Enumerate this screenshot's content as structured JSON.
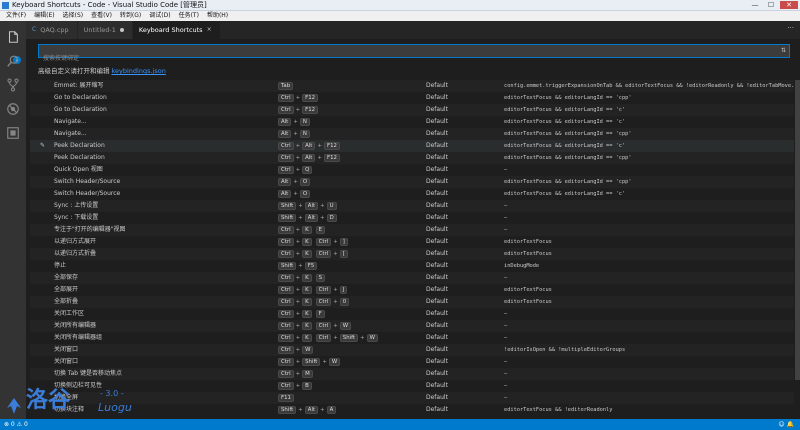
{
  "window": {
    "title": "Keyboard Shortcuts - Code - Visual Studio Code [管理员]",
    "minimize": "—",
    "maximize": "☐",
    "close": "✕"
  },
  "menu": [
    "文件(F)",
    "编辑(E)",
    "选择(S)",
    "查看(V)",
    "转到(G)",
    "调试(D)",
    "任务(T)",
    "帮助(H)"
  ],
  "activity": {
    "badge": "1",
    "icons": [
      "files-icon",
      "search-icon",
      "source-control-icon",
      "debug-icon",
      "extensions-icon"
    ]
  },
  "tabs": [
    {
      "label": "QAQ.cpp",
      "icon": "C",
      "active": false
    },
    {
      "label": "Untitled-1",
      "icon": "",
      "active": false
    },
    {
      "label": "Keyboard Shortcuts",
      "icon": "",
      "active": true
    }
  ],
  "tab_close": "×",
  "tabbar_more": "···",
  "search": {
    "placeholder": "搜索按键绑定",
    "sort_icon": "⇅"
  },
  "hint": {
    "text": "高级自定义请打开和编辑",
    "link": "keybindings.json"
  },
  "edit_icon": "✎",
  "rows": [
    {
      "cmd": "Emmet: 展开缩写",
      "keys": [
        [
          "Tab"
        ]
      ],
      "src": "Default",
      "when": "config.emmet.triggerExpansionOnTab && editorTextFocus && !editorReadonly && !editorTabMove..."
    },
    {
      "cmd": "Go to Declaration",
      "keys": [
        [
          "Ctrl",
          "F12"
        ]
      ],
      "src": "Default",
      "when": "editorTextFocus && editorLangId == 'cpp'"
    },
    {
      "cmd": "Go to Declaration",
      "keys": [
        [
          "Ctrl",
          "F12"
        ]
      ],
      "src": "Default",
      "when": "editorTextFocus && editorLangId == 'c'"
    },
    {
      "cmd": "Navigate...",
      "keys": [
        [
          "Alt",
          "N"
        ]
      ],
      "src": "Default",
      "when": "editorTextFocus && editorLangId == 'c'"
    },
    {
      "cmd": "Navigate...",
      "keys": [
        [
          "Alt",
          "N"
        ]
      ],
      "src": "Default",
      "when": "editorTextFocus && editorLangId == 'cpp'"
    },
    {
      "cmd": "Peek Declaration",
      "keys": [
        [
          "Ctrl",
          "Alt",
          "F12"
        ]
      ],
      "src": "Default",
      "when": "editorTextFocus && editorLangId == 'c'",
      "selected": true
    },
    {
      "cmd": "Peek Declaration",
      "keys": [
        [
          "Ctrl",
          "Alt",
          "F12"
        ]
      ],
      "src": "Default",
      "when": "editorTextFocus && editorLangId == 'cpp'"
    },
    {
      "cmd": "Quick Open 视图",
      "keys": [
        [
          "Ctrl",
          "Q"
        ]
      ],
      "src": "Default",
      "when": "—"
    },
    {
      "cmd": "Switch Header/Source",
      "keys": [
        [
          "Alt",
          "O"
        ]
      ],
      "src": "Default",
      "when": "editorTextFocus && editorLangId == 'cpp'"
    },
    {
      "cmd": "Switch Header/Source",
      "keys": [
        [
          "Alt",
          "O"
        ]
      ],
      "src": "Default",
      "when": "editorTextFocus && editorLangId == 'c'"
    },
    {
      "cmd": "Sync : 上传设置",
      "keys": [
        [
          "Shift",
          "Alt",
          "U"
        ]
      ],
      "src": "Default",
      "when": "—"
    },
    {
      "cmd": "Sync : 下载设置",
      "keys": [
        [
          "Shift",
          "Alt",
          "D"
        ]
      ],
      "src": "Default",
      "when": "—"
    },
    {
      "cmd": "专注于\"打开的编辑器\"视图",
      "keys": [
        [
          "Ctrl",
          "K"
        ],
        [
          "E"
        ]
      ],
      "src": "Default",
      "when": "—"
    },
    {
      "cmd": "以递归方式展开",
      "keys": [
        [
          "Ctrl",
          "K"
        ],
        [
          "Ctrl",
          "]"
        ]
      ],
      "src": "Default",
      "when": "editorTextFocus"
    },
    {
      "cmd": "以递归方式折叠",
      "keys": [
        [
          "Ctrl",
          "K"
        ],
        [
          "Ctrl",
          "["
        ]
      ],
      "src": "Default",
      "when": "editorTextFocus"
    },
    {
      "cmd": "停止",
      "keys": [
        [
          "Shift",
          "F5"
        ]
      ],
      "src": "Default",
      "when": "inDebugMode"
    },
    {
      "cmd": "全部保存",
      "keys": [
        [
          "Ctrl",
          "K"
        ],
        [
          "S"
        ]
      ],
      "src": "Default",
      "when": "—"
    },
    {
      "cmd": "全部展开",
      "keys": [
        [
          "Ctrl",
          "K"
        ],
        [
          "Ctrl",
          "J"
        ]
      ],
      "src": "Default",
      "when": "editorTextFocus"
    },
    {
      "cmd": "全部折叠",
      "keys": [
        [
          "Ctrl",
          "K"
        ],
        [
          "Ctrl",
          "0"
        ]
      ],
      "src": "Default",
      "when": "editorTextFocus"
    },
    {
      "cmd": "关闭工作区",
      "keys": [
        [
          "Ctrl",
          "K"
        ],
        [
          "F"
        ]
      ],
      "src": "Default",
      "when": "—"
    },
    {
      "cmd": "关闭所有编辑器",
      "keys": [
        [
          "Ctrl",
          "K"
        ],
        [
          "Ctrl",
          "W"
        ]
      ],
      "src": "Default",
      "when": "—"
    },
    {
      "cmd": "关闭所有编辑器组",
      "keys": [
        [
          "Ctrl",
          "K"
        ],
        [
          "Ctrl",
          "Shift",
          "W"
        ]
      ],
      "src": "Default",
      "when": "—"
    },
    {
      "cmd": "关闭窗口",
      "keys": [
        [
          "Ctrl",
          "W"
        ]
      ],
      "src": "Default",
      "when": "!editorIsOpen && !multipleEditorGroups"
    },
    {
      "cmd": "关闭窗口",
      "keys": [
        [
          "Ctrl",
          "Shift",
          "W"
        ]
      ],
      "src": "Default",
      "when": "—"
    },
    {
      "cmd": "切换 Tab 键是否移动焦点",
      "keys": [
        [
          "Ctrl",
          "M"
        ]
      ],
      "src": "Default",
      "when": "—"
    },
    {
      "cmd": "切换侧边栏可见性",
      "keys": [
        [
          "Ctrl",
          "B"
        ]
      ],
      "src": "Default",
      "when": "—"
    },
    {
      "cmd": "切换全屏",
      "keys": [
        [
          "F11"
        ]
      ],
      "src": "Default",
      "when": "—"
    },
    {
      "cmd": "切换块注释",
      "keys": [
        [
          "Shift",
          "Alt",
          "A"
        ]
      ],
      "src": "Default",
      "when": "editorTextFocus && !editorReadonly"
    }
  ],
  "status": {
    "left": "⊗ 0  ⚠ 0",
    "right": "☺  🔔"
  },
  "watermark": {
    "name": "洛谷",
    "latin": "Luogu",
    "version": "- 3.0 -"
  },
  "colors": {
    "accent": "#007acc",
    "link": "#3794ff"
  }
}
